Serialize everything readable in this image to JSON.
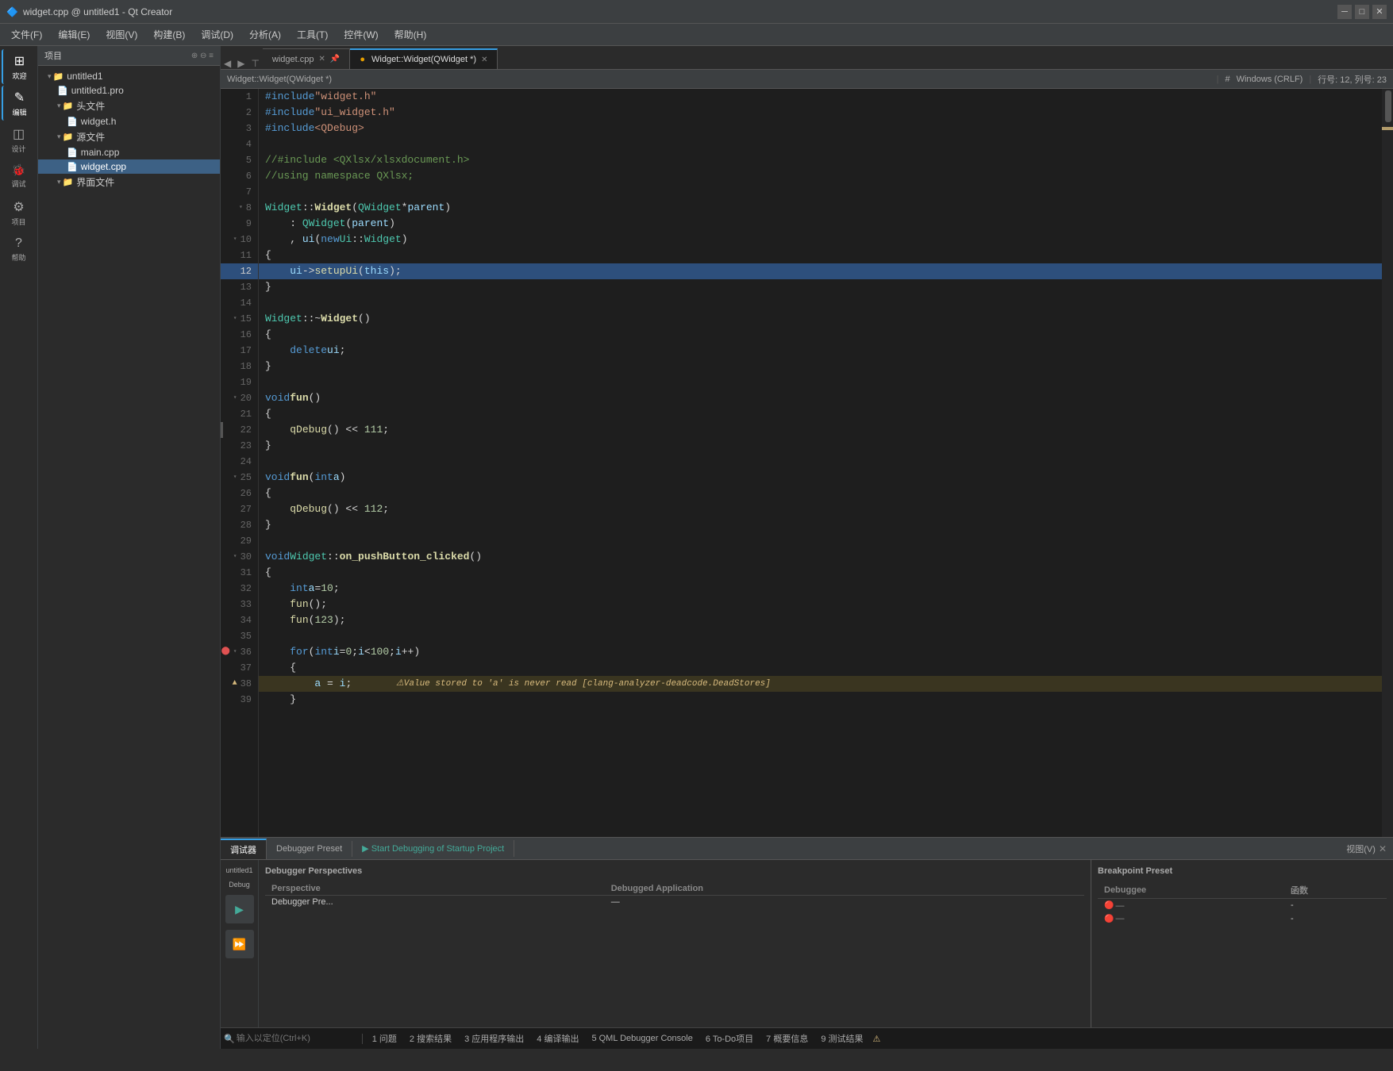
{
  "titlebar": {
    "title": "widget.cpp @ untitled1 - Qt Creator",
    "icon": "🔷"
  },
  "menubar": {
    "items": [
      "文件(F)",
      "编辑(E)",
      "视图(V)",
      "构建(B)",
      "调试(D)",
      "分析(A)",
      "工具(T)",
      "控件(W)",
      "帮助(H)"
    ]
  },
  "sidebar": {
    "icons": [
      {
        "id": "welcome",
        "symbol": "⊞",
        "label": "欢迎"
      },
      {
        "id": "edit",
        "symbol": "✎",
        "label": "编辑"
      },
      {
        "id": "design",
        "symbol": "◫",
        "label": "设计"
      },
      {
        "id": "debug",
        "symbol": "🐞",
        "label": "调试"
      },
      {
        "id": "project",
        "symbol": "⚙",
        "label": "项目"
      },
      {
        "id": "help",
        "symbol": "?",
        "label": "帮助"
      }
    ]
  },
  "project_panel": {
    "header": "项目",
    "tree": [
      {
        "indent": 1,
        "label": "untitled1",
        "icon": "▾",
        "type": "folder"
      },
      {
        "indent": 2,
        "label": "untitled1.pro",
        "icon": "📄",
        "type": "file"
      },
      {
        "indent": 2,
        "label": "头文件",
        "icon": "▾",
        "type": "folder"
      },
      {
        "indent": 3,
        "label": "widget.h",
        "icon": "📄",
        "type": "file"
      },
      {
        "indent": 2,
        "label": "源文件",
        "icon": "▾",
        "type": "folder"
      },
      {
        "indent": 3,
        "label": "main.cpp",
        "icon": "📄",
        "type": "file"
      },
      {
        "indent": 3,
        "label": "widget.cpp",
        "icon": "📄",
        "type": "file",
        "active": true
      },
      {
        "indent": 2,
        "label": "界面文件",
        "icon": "▾",
        "type": "folder"
      }
    ]
  },
  "tabs": {
    "items": [
      {
        "label": "widget.cpp",
        "active": false,
        "modified": false
      },
      {
        "label": "Widget::Widget(QWidget *)",
        "active": true,
        "modified": true
      }
    ],
    "nav_arrows": [
      "◀",
      "▶"
    ]
  },
  "editor_info": {
    "function": "Widget::Widget(QWidget *)",
    "line_ending": "Windows (CRLF)",
    "position": "行号: 12, 列号: 23"
  },
  "code": {
    "lines": [
      {
        "num": 1,
        "content": "#include \"widget.h\"",
        "type": "normal"
      },
      {
        "num": 2,
        "content": "#include \"ui_widget.h\"",
        "type": "normal"
      },
      {
        "num": 3,
        "content": "#include <QDebug>",
        "type": "normal"
      },
      {
        "num": 4,
        "content": "",
        "type": "normal"
      },
      {
        "num": 5,
        "content": "//#include <QXlsx/xlsxdocument.h>",
        "type": "comment"
      },
      {
        "num": 6,
        "content": "//using namespace QXlsx;",
        "type": "comment"
      },
      {
        "num": 7,
        "content": "",
        "type": "normal"
      },
      {
        "num": 8,
        "content": "Widget::Widget(QWidget* parent)",
        "type": "normal",
        "fold": true
      },
      {
        "num": 9,
        "content": "    : QWidget(parent)",
        "type": "normal"
      },
      {
        "num": 10,
        "content": "    , ui(new Ui::Widget)",
        "type": "normal",
        "fold": true
      },
      {
        "num": 11,
        "content": "{",
        "type": "normal"
      },
      {
        "num": 12,
        "content": "    ui->setupUi(this);",
        "type": "active"
      },
      {
        "num": 13,
        "content": "}",
        "type": "normal"
      },
      {
        "num": 14,
        "content": "",
        "type": "normal"
      },
      {
        "num": 15,
        "content": "Widget::~Widget()",
        "type": "normal",
        "fold": true
      },
      {
        "num": 16,
        "content": "{",
        "type": "normal"
      },
      {
        "num": 17,
        "content": "    delete ui;",
        "type": "normal"
      },
      {
        "num": 18,
        "content": "}",
        "type": "normal"
      },
      {
        "num": 19,
        "content": "",
        "type": "normal"
      },
      {
        "num": 20,
        "content": "void fun()",
        "type": "normal",
        "fold": true
      },
      {
        "num": 21,
        "content": "{",
        "type": "normal"
      },
      {
        "num": 22,
        "content": "    qDebug() << 111;",
        "type": "normal"
      },
      {
        "num": 23,
        "content": "}",
        "type": "normal"
      },
      {
        "num": 24,
        "content": "",
        "type": "normal"
      },
      {
        "num": 25,
        "content": "void fun(int a)",
        "type": "normal",
        "fold": true
      },
      {
        "num": 26,
        "content": "{",
        "type": "normal"
      },
      {
        "num": 27,
        "content": "    qDebug() << 112;",
        "type": "normal"
      },
      {
        "num": 28,
        "content": "}",
        "type": "normal"
      },
      {
        "num": 29,
        "content": "",
        "type": "normal"
      },
      {
        "num": 30,
        "content": "void Widget::on_pushButton_clicked()",
        "type": "normal",
        "fold": true
      },
      {
        "num": 31,
        "content": "{",
        "type": "normal"
      },
      {
        "num": 32,
        "content": "    int a = 10;",
        "type": "normal"
      },
      {
        "num": 33,
        "content": "    fun();",
        "type": "normal"
      },
      {
        "num": 34,
        "content": "    fun(123);",
        "type": "normal"
      },
      {
        "num": 35,
        "content": "",
        "type": "normal"
      },
      {
        "num": 36,
        "content": "    for (int i = 0; i < 100; i++)",
        "type": "normal",
        "fold": true,
        "breakpoint": true
      },
      {
        "num": 37,
        "content": "    {",
        "type": "normal"
      },
      {
        "num": 38,
        "content": "        a = i;",
        "type": "warning",
        "warning_text": "⚠Value stored to 'a' is never read [clang-analyzer-deadcode.DeadStores]"
      },
      {
        "num": 39,
        "content": "    }",
        "type": "normal"
      }
    ]
  },
  "debug_panel": {
    "tabs": [
      "调试器",
      "Debugger Preset",
      "▶ Start Debugging of Startup Project",
      "视图(V)"
    ],
    "left": {
      "title": "Debugger Perspectives",
      "columns": [
        "Perspective",
        "Debugged Application"
      ],
      "rows": [
        {
          "perspective": "Debugger Pre...",
          "app": "—"
        }
      ]
    },
    "right": {
      "title": "Breakpoint Preset",
      "columns": [
        "Debuggee",
        "函数"
      ],
      "rows": [
        {
          "debuggee": "—",
          "func": "-"
        },
        {
          "debuggee": "—",
          "func": "-"
        }
      ]
    }
  },
  "debug_sidebar": {
    "label": "untitled1",
    "sub_label": "Debug",
    "buttons": [
      "▶",
      "⏩"
    ]
  },
  "statusbar": {
    "search_placeholder": "输入以定位(Ctrl+K)",
    "tabs": [
      "1 问题",
      "2 搜索结果",
      "3 应用程序输出",
      "4 编译输出",
      "5 QML Debugger Console",
      "6 To-Do项目",
      "7 概要信息",
      "9 测试结果"
    ],
    "warning_icon": "⚠"
  }
}
